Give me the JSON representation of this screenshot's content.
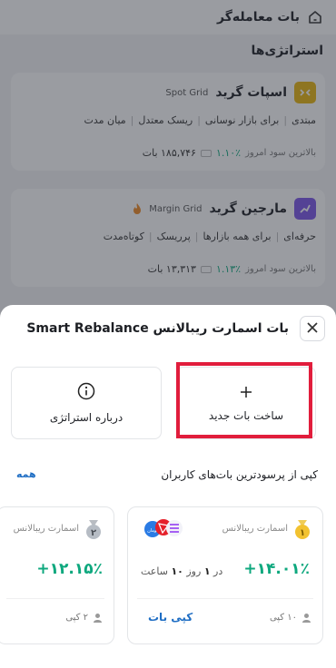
{
  "header": {
    "title": "بات معامله‌گر",
    "home_icon": "home-icon"
  },
  "section": {
    "title": "استراتژی‌ها"
  },
  "cards": [
    {
      "name": "اسپات گرید",
      "sub": "Spot Grid",
      "tags": [
        "مبتدی",
        "برای بازار نوسانی",
        "ریسک معتدل",
        "میان مدت"
      ],
      "stat_label": "بالاترین سود امروز",
      "stat_value": "۱.۱۰٪",
      "amount": "۱۸۵,۷۴۶ بات",
      "icon": "spot-grid-icon",
      "color": "#e8b60f"
    },
    {
      "name": "مارجین گرید",
      "sub": "Margin Grid",
      "tags": [
        "حرفه‌ای",
        "برای همه بازارها",
        "پرریسک",
        "کوتاه‌مدت"
      ],
      "stat_label": "بالاترین سود امروز",
      "stat_value": "۱.۱۳٪",
      "amount": "۱۳,۳۱۳ بات",
      "icon": "margin-grid-icon",
      "color": "#7b55e8"
    }
  ],
  "sheet": {
    "title": "بات اسمارت ریبالانس Smart Rebalance",
    "close_icon": "close-icon",
    "new_bot_label": "ساخت بات جدید",
    "about_label": "درباره استراتژی",
    "copy_title": "کپی از پرسودترین بات‌های کاربران",
    "all_label": "همه",
    "highlight_color": "#e11d3c",
    "bots": [
      {
        "name": "اسمارت ریبالانس",
        "rank": "۱",
        "roi": "+۱۴.۰۱٪",
        "runtime_prefix": "در",
        "runtime_days": "۱",
        "runtime_mid": "روز",
        "runtime_hours": "۱۰",
        "runtime_suffix": "ساعت",
        "copies": "۱۰ کپی",
        "copy_label": "کپی بات",
        "coin_badge": "تومان"
      },
      {
        "name": "اسمارت ریبالانس",
        "rank": "۲",
        "roi": "+۱۲.۱۵٪",
        "copies": "۲ کپی"
      }
    ]
  }
}
